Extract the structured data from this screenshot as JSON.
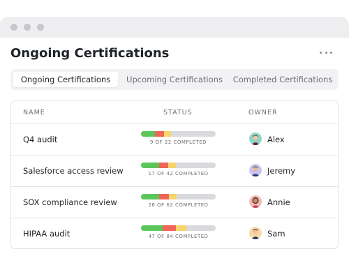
{
  "header": {
    "title": "Ongoing Certifications"
  },
  "tabs": [
    {
      "label": "Ongoing Certifications",
      "active": true
    },
    {
      "label": "Upcoming Certifications",
      "active": false
    },
    {
      "label": "Completed Certifications",
      "active": false
    }
  ],
  "table": {
    "columns": [
      "NAME",
      "STATUS",
      "OWNER"
    ],
    "rows": [
      {
        "name": "Q4 audit",
        "status": "9 OF 22 COMPLETED",
        "progress": {
          "green": 0.19,
          "red": 0.12,
          "yellow": 0.09
        },
        "owner": "Alex",
        "avatar_bg": "#8fd3c7"
      },
      {
        "name": "Salesforce access review",
        "status": "17 OF 42 COMPLETED",
        "progress": {
          "green": 0.24,
          "red": 0.12,
          "yellow": 0.1
        },
        "owner": "Jeremy",
        "avatar_bg": "#c9c3f2"
      },
      {
        "name": "SOX compliance review",
        "status": "26 OF 62 COMPLETED",
        "progress": {
          "green": 0.24,
          "red": 0.13,
          "yellow": 0.1
        },
        "owner": "Annie",
        "avatar_bg": "#f3b9b6"
      },
      {
        "name": "HIPAA audit",
        "status": "47 OF 84 COMPLETED",
        "progress": {
          "green": 0.29,
          "red": 0.18,
          "yellow": 0.14
        },
        "owner": "Sam",
        "avatar_bg": "#f6d8a8"
      }
    ]
  },
  "colors": {
    "green": "#5cc65b",
    "red": "#f0645a",
    "yellow": "#f8d56b",
    "track": "#d9dadd"
  },
  "icons": [
    "more-options-icon",
    "avatar"
  ]
}
